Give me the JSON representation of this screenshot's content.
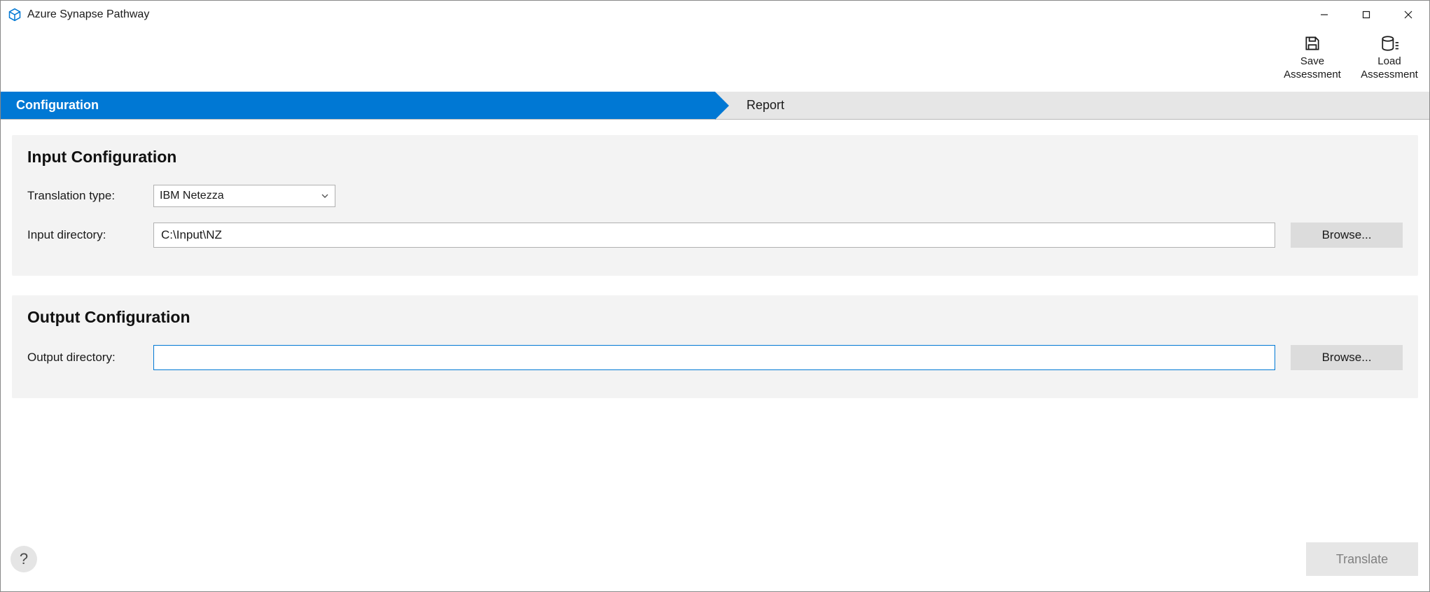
{
  "window": {
    "title": "Azure Synapse Pathway"
  },
  "toolbar": {
    "save_label_line1": "Save",
    "save_label_line2": "Assessment",
    "load_label_line1": "Load",
    "load_label_line2": "Assessment"
  },
  "wizard": {
    "step1": "Configuration",
    "step2": "Report"
  },
  "panels": {
    "input": {
      "title": "Input Configuration",
      "translation_type_label": "Translation type:",
      "translation_type_value": "IBM Netezza",
      "input_dir_label": "Input directory:",
      "input_dir_value": "C:\\Input\\NZ",
      "browse_label": "Browse..."
    },
    "output": {
      "title": "Output Configuration",
      "output_dir_label": "Output directory:",
      "output_dir_value": "",
      "browse_label": "Browse..."
    }
  },
  "footer": {
    "help_label": "?",
    "translate_label": "Translate"
  }
}
